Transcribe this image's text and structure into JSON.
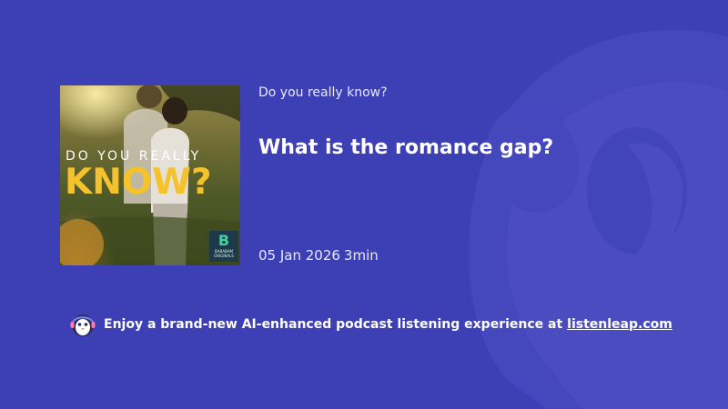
{
  "colors": {
    "background": "#3d3fb5",
    "watermark": "#4a4cc0",
    "cover_title_accent": "#f6c22c",
    "text": "#ffffff"
  },
  "background_logo": {
    "icon": "listenleap-headphone-watermark-icon"
  },
  "cover": {
    "line1": "DO YOU REALLY",
    "line2": "KNOW?",
    "badge_letter": "B",
    "badge_text": "BABABAM ORIGINALS"
  },
  "podcast": {
    "show_title": "Do you really know?",
    "episode_title": "What is the romance gap?",
    "date": "05 Jan 2026",
    "duration": "3min"
  },
  "promo": {
    "mascot_icon": "penguin-headphones-icon",
    "text": "Enjoy a brand-new AI-enhanced podcast listening experience at",
    "link": "listenleap.com"
  }
}
